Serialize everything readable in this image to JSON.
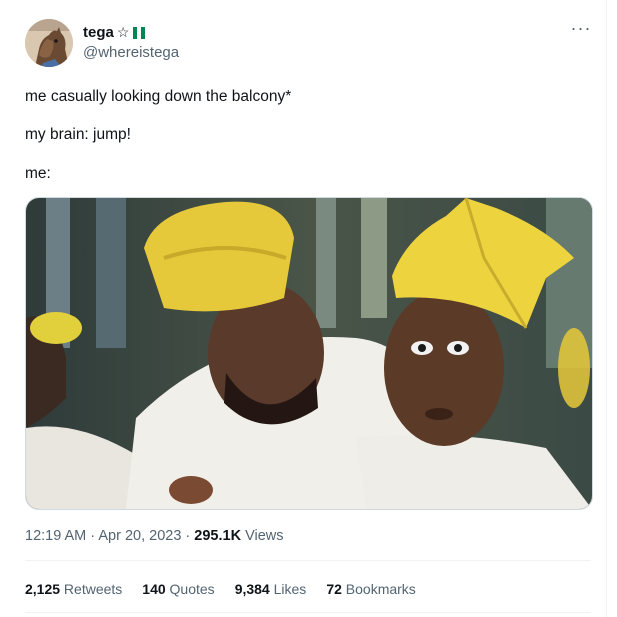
{
  "author": {
    "display_name": "tega",
    "star_glyph": "☆",
    "flag_icon": "nigeria-flag",
    "handle": "@whereistega"
  },
  "more_icon": "more-dots-icon",
  "tweet": {
    "line1": "me casually looking down the balcony*",
    "line2": "my brain: jump!",
    "line3": "me:"
  },
  "meta": {
    "time": "12:19 AM",
    "sep1": " · ",
    "date": "Apr 20, 2023",
    "sep2": " · ",
    "views_count": "295.1K",
    "views_label": " Views"
  },
  "stats": {
    "retweets_count": "2,125",
    "retweets_label": " Retweets",
    "quotes_count": "140",
    "quotes_label": " Quotes",
    "likes_count": "9,384",
    "likes_label": " Likes",
    "bookmarks_count": "72",
    "bookmarks_label": " Bookmarks"
  },
  "colors": {
    "text": "#0f1419",
    "secondary": "#536471",
    "border": "#eff3f4",
    "flag_green": "#008751"
  }
}
